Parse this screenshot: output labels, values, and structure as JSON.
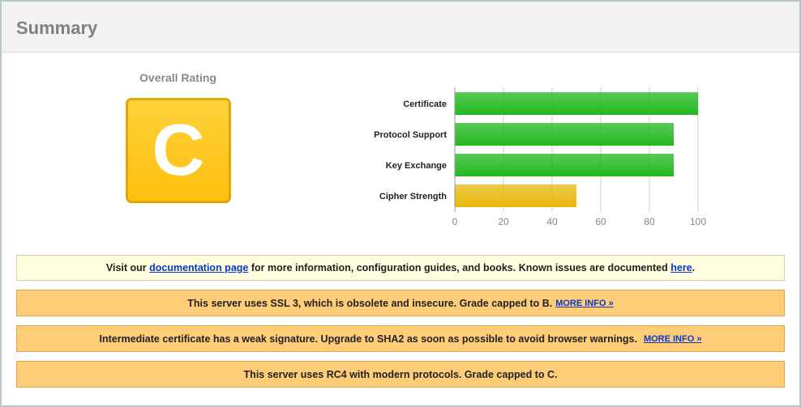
{
  "summary": {
    "title": "Summary",
    "overall_rating_label": "Overall Rating",
    "grade": "C",
    "grade_color": "#ffc81e"
  },
  "chart_data": {
    "type": "bar",
    "orientation": "horizontal",
    "categories": [
      "Certificate",
      "Protocol Support",
      "Key Exchange",
      "Cipher Strength"
    ],
    "values": [
      100,
      90,
      90,
      50
    ],
    "bar_colors": [
      "#22b81f",
      "#22b81f",
      "#22b81f",
      "#e8b80a"
    ],
    "xlim": [
      0,
      100
    ],
    "xticks": [
      "0",
      "20",
      "40",
      "60",
      "80",
      "100"
    ],
    "grid": true
  },
  "notices": {
    "docs": {
      "prefix": "Visit our ",
      "link1": "documentation page",
      "middle": " for more information, configuration guides, and books. Known issues are documented ",
      "link2": "here",
      "suffix": "."
    },
    "ssl3": {
      "text": "This server uses SSL 3, which is obsolete and insecure. Grade capped to B.",
      "more": "MORE INFO »"
    },
    "intermediate": {
      "text": "Intermediate certificate has a weak signature. Upgrade to SHA2 as soon as possible to avoid browser warnings.",
      "more": "MORE INFO »"
    },
    "rc4": {
      "text": "This server uses RC4 with modern protocols. Grade capped to C."
    }
  }
}
